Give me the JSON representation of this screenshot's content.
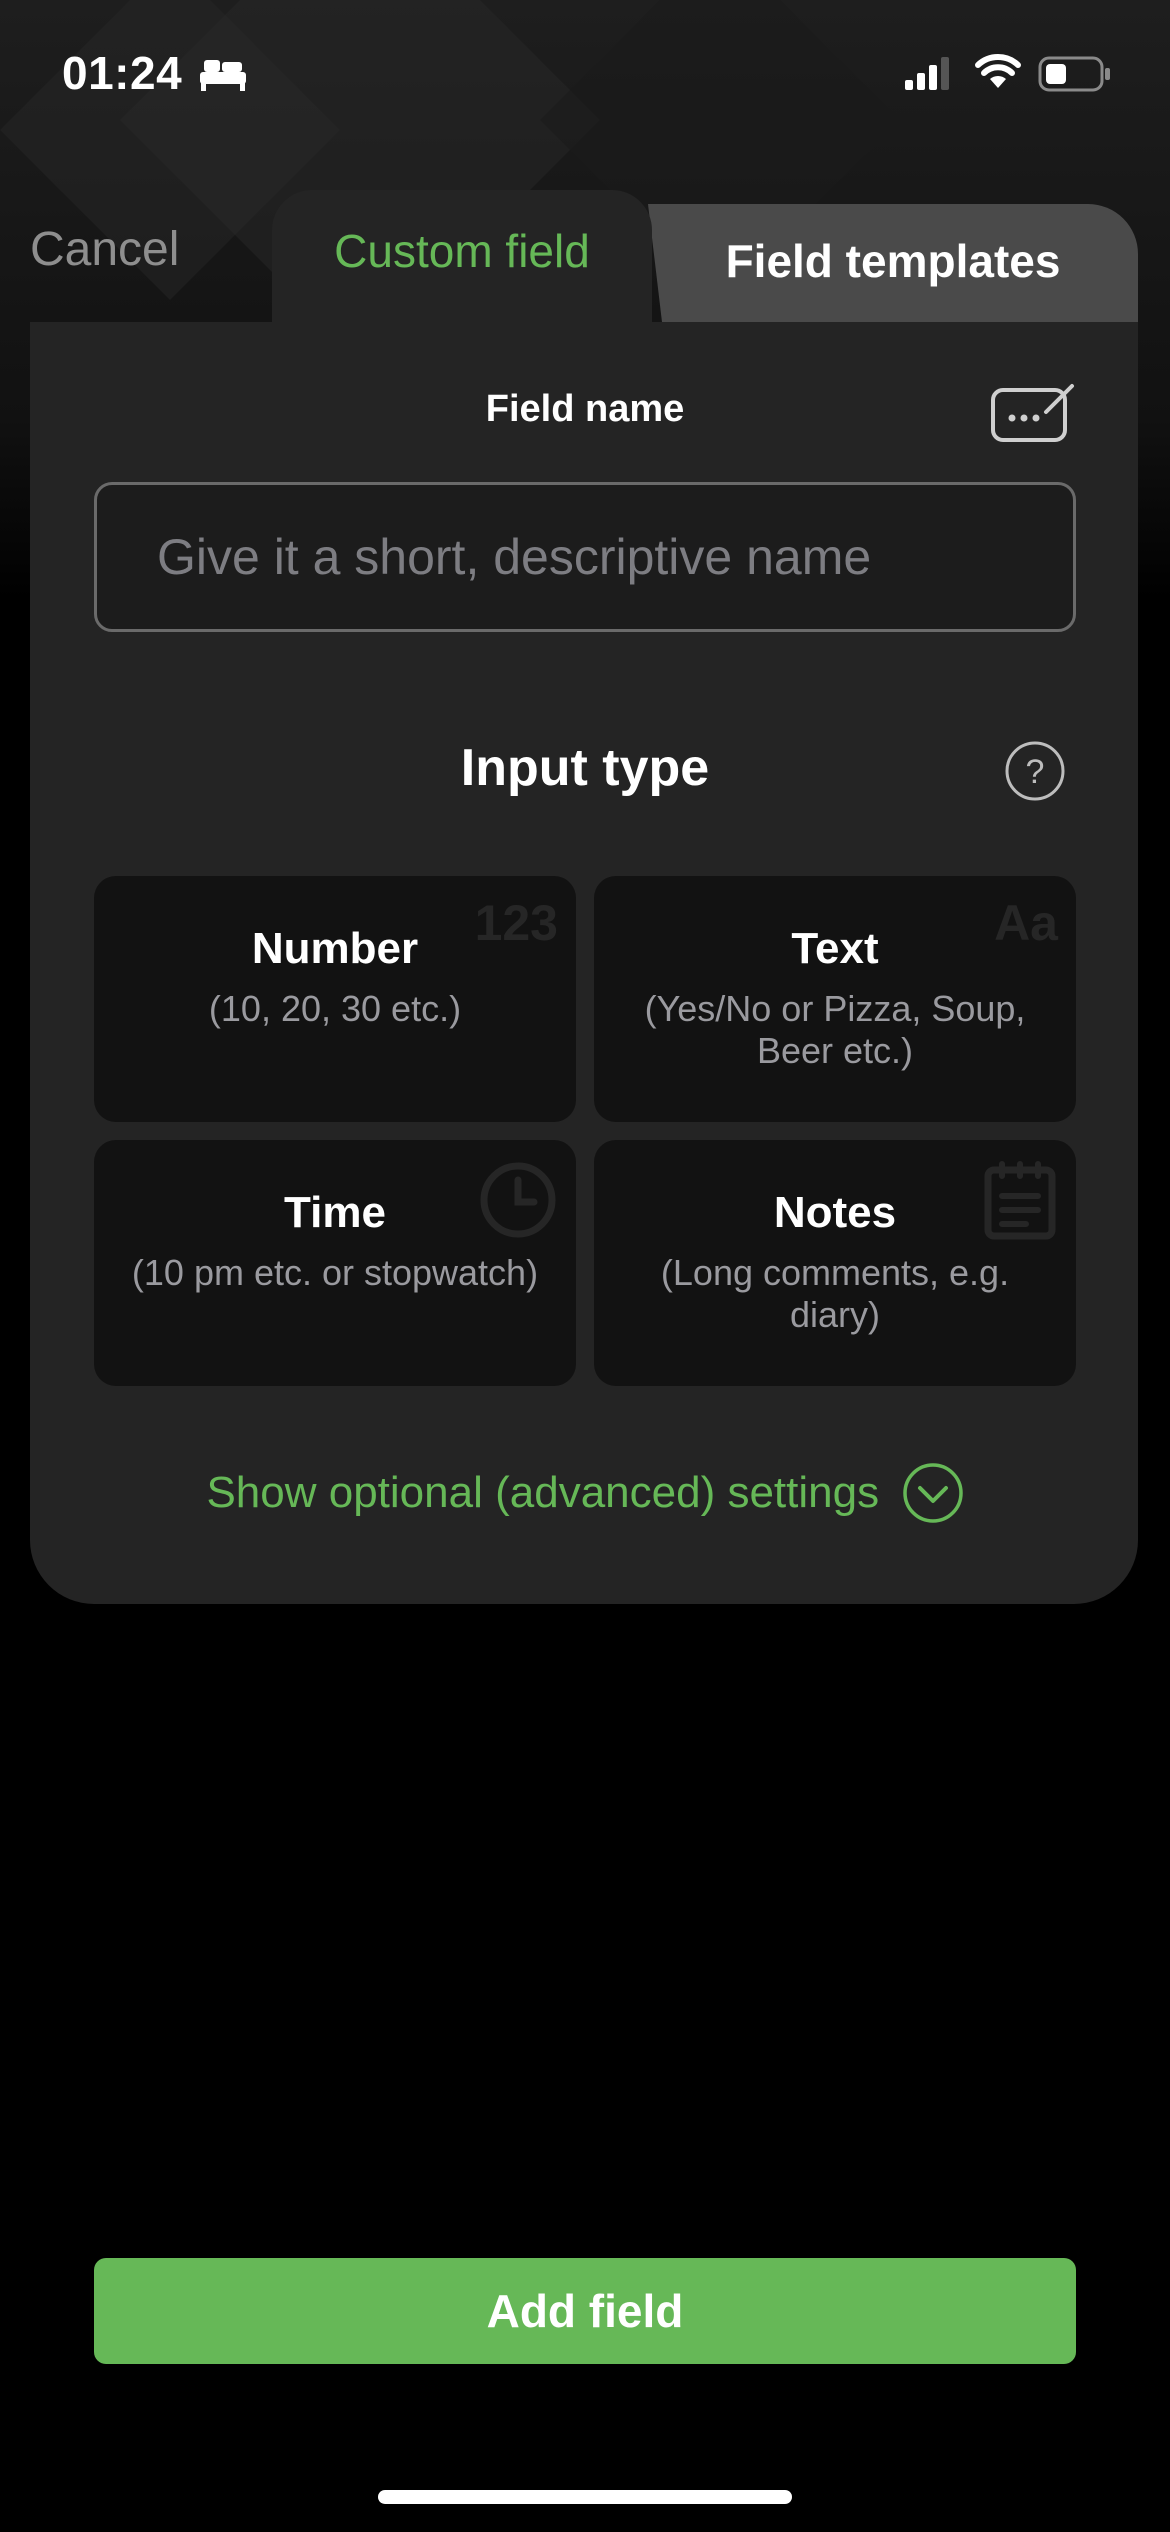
{
  "status_bar": {
    "time": "01:24"
  },
  "header": {
    "cancel_label": "Cancel",
    "tabs": [
      {
        "label": "Custom field",
        "active": true
      },
      {
        "label": "Field templates",
        "active": false
      }
    ]
  },
  "form": {
    "field_name_label": "Field name",
    "field_name_placeholder": "Give it a short, descriptive name",
    "field_name_value": "",
    "input_type_label": "Input type",
    "input_types": [
      {
        "title": "Number",
        "desc": "(10, 20, 30 etc.)",
        "watermark": "123"
      },
      {
        "title": "Text",
        "desc": "(Yes/No or Pizza, Soup, Beer etc.)",
        "watermark": "Aa"
      },
      {
        "title": "Time",
        "desc": "(10 pm etc. or stopwatch)",
        "watermark": "clock-icon"
      },
      {
        "title": "Notes",
        "desc": "(Long comments, e.g. diary)",
        "watermark": "notepad-icon"
      }
    ],
    "advanced_label": "Show optional (advanced) settings"
  },
  "footer": {
    "add_button_label": "Add field"
  },
  "colors": {
    "accent": "#66b857",
    "card": "#242424",
    "tile": "#121212",
    "templates_tab": "#4a4a4a"
  }
}
